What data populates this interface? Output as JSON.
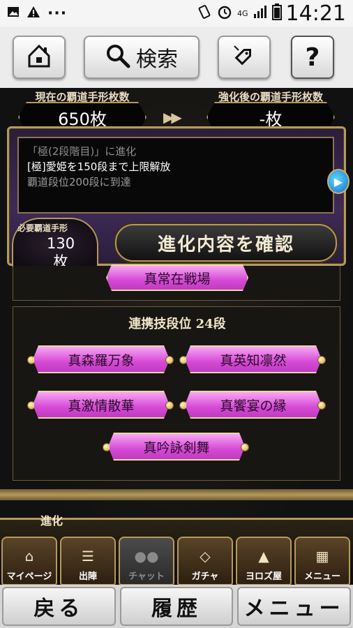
{
  "status_bar": {
    "time": "14:21",
    "network": "4G",
    "icons": [
      "image-icon",
      "warning-icon",
      "more-icon",
      "vibrate-icon",
      "alarm-icon",
      "signal-icon",
      "battery-icon"
    ],
    "more": "···"
  },
  "toolbar": {
    "search_label": "検索",
    "help_label": "?"
  },
  "upgrade": {
    "current_title": "現在の覇道手形枚数",
    "current_value": "650枚",
    "after_title": "強化後の覇道手形枚数",
    "after_value": "-枚",
    "arrows": "▶▶"
  },
  "evolution": {
    "lines": [
      "「極(2段階目)」に進化",
      "[極]愛姫を150段まで上限解放",
      "覇道段位200段に到達"
    ],
    "required_label": "必要覇道手形",
    "required_value_number": "130",
    "required_value_unit": "枚",
    "confirm_label": "進化内容を確認"
  },
  "skills": {
    "partial_button": "真常在戦場",
    "heading": "連携技段位 24段",
    "buttons": [
      "真森羅万象",
      "真英知凛然",
      "真激情散華",
      "真饗宴の縁",
      "真吟詠剣舞"
    ]
  },
  "game_nav": {
    "tag": "進化",
    "items": [
      {
        "label": "マイページ",
        "icon": "home-icon"
      },
      {
        "label": "出陣",
        "icon": "map-icon"
      },
      {
        "label": "チャット",
        "icon": "chat-icon"
      },
      {
        "label": "ガチャ",
        "icon": "gacha-icon"
      },
      {
        "label": "ヨロズ屋",
        "icon": "shop-icon"
      },
      {
        "label": "メニュー",
        "icon": "menu-icon"
      }
    ]
  },
  "system_bar": {
    "back": "戻る",
    "history": "履歴",
    "menu": "メニュー"
  },
  "colors": {
    "gold": "#b69a5a",
    "pink": "#d64ad6",
    "purple": "#3f2a57"
  }
}
